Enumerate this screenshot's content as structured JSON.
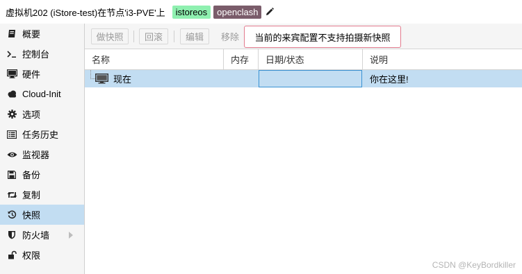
{
  "header": {
    "title": "虚拟机202 (iStore-test)在节点'i3-PVE'上",
    "tags": [
      {
        "label": "istoreos",
        "bg": "#8ff0b0",
        "color": "#000000"
      },
      {
        "label": "openclash",
        "bg": "#7a5c6a",
        "color": "#ffffff"
      }
    ],
    "edit_icon": "pencil-icon"
  },
  "sidebar": {
    "items": [
      {
        "label": "概要",
        "icon": "book-icon"
      },
      {
        "label": "控制台",
        "icon": "terminal-icon"
      },
      {
        "label": "硬件",
        "icon": "monitor-icon"
      },
      {
        "label": "Cloud-Init",
        "icon": "cloud-icon"
      },
      {
        "label": "选项",
        "icon": "gear-icon"
      },
      {
        "label": "任务历史",
        "icon": "list-icon"
      },
      {
        "label": "监视器",
        "icon": "eye-icon"
      },
      {
        "label": "备份",
        "icon": "floppy-icon"
      },
      {
        "label": "复制",
        "icon": "retweet-icon"
      },
      {
        "label": "快照",
        "icon": "history-icon",
        "active": true
      },
      {
        "label": "防火墙",
        "icon": "shield-icon",
        "has_submenu": true
      },
      {
        "label": "权限",
        "icon": "unlock-icon"
      }
    ]
  },
  "toolbar": {
    "snapshot_label": "做快照",
    "rollback_label": "回滚",
    "edit_label": "编辑",
    "remove_label": "移除",
    "warning_text": "当前的来宾配置不支持拍摄新快照"
  },
  "grid": {
    "columns": [
      "名称",
      "内存",
      "日期/状态",
      "说明"
    ],
    "rows": [
      {
        "name": "现在",
        "ram": "",
        "date": "",
        "description": "你在这里!",
        "icon": "monitor-icon",
        "selected": true
      }
    ]
  },
  "watermark": "CSDN @KeyBordkiller",
  "colors": {
    "accent": "#c2ddf2",
    "warning_border": "#e27a8d",
    "focus": "#3892d4"
  }
}
